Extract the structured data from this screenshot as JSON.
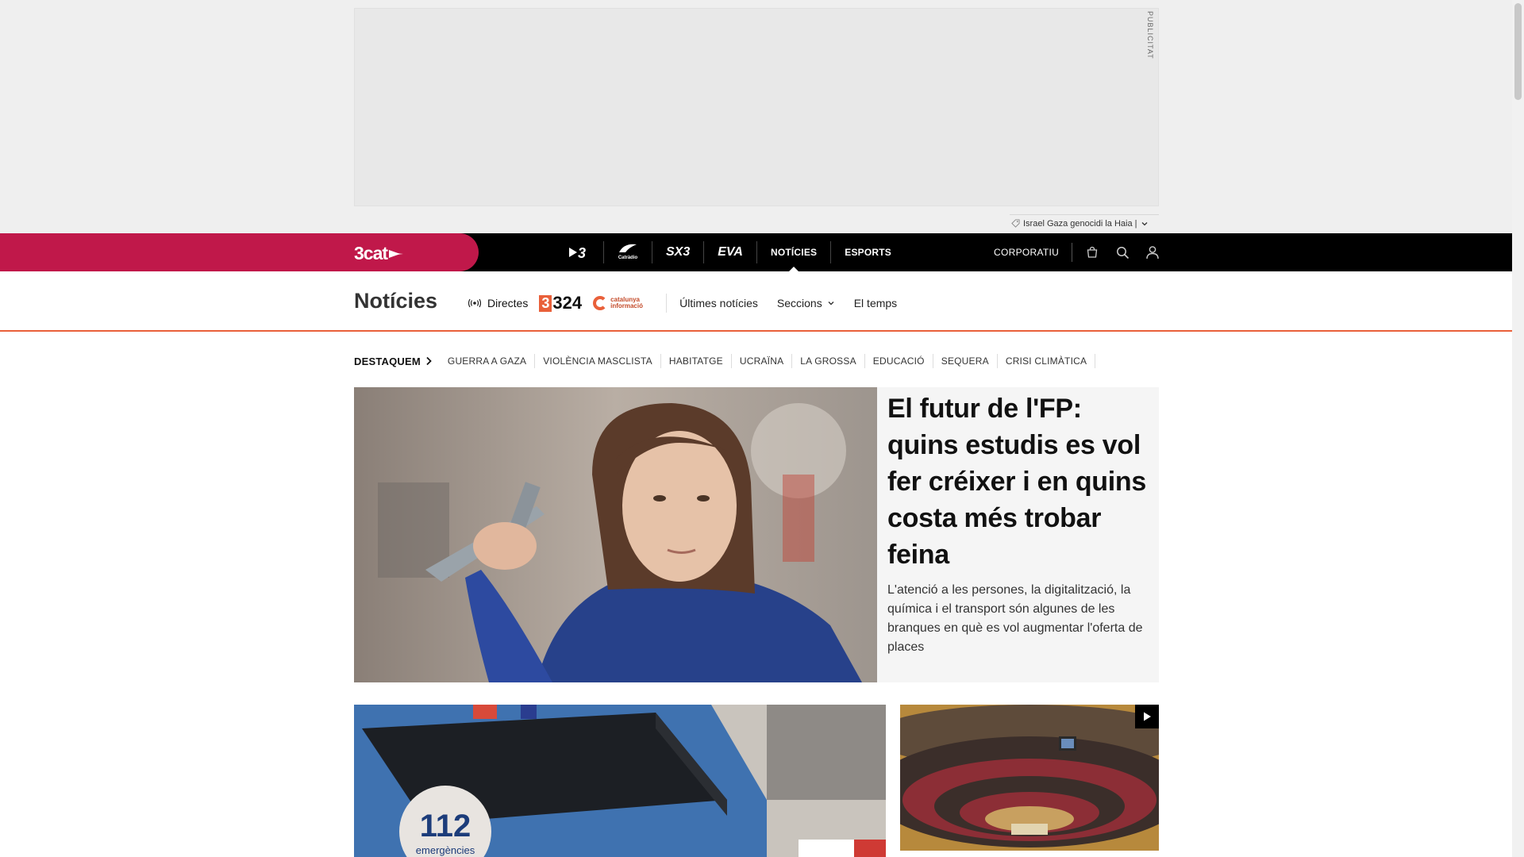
{
  "ad": {
    "label": "PUBLICITAT",
    "ticker_text": "Israel Gaza genocidi la Haia |"
  },
  "global_nav": {
    "brand": "3cat",
    "channels": [
      {
        "name": "3"
      },
      {
        "name": "Catràdio"
      },
      {
        "name": "SX3"
      },
      {
        "name": "EVA"
      }
    ],
    "links": [
      {
        "label": "NOTÍCIES",
        "active": true
      },
      {
        "label": "ESPORTS",
        "active": false
      }
    ],
    "corporate": "CORPORATIU",
    "icons": [
      "shopping-bag-icon",
      "search-icon",
      "user-icon"
    ]
  },
  "section": {
    "title": "Notícies",
    "directes": "Directes",
    "logo_324": "324",
    "logo_ci": "catalunya informació",
    "links": [
      "Últimes notícies",
      "Seccions",
      "El temps"
    ]
  },
  "highlights": {
    "title": "DESTAQUEM",
    "items": [
      "GUERRA A GAZA",
      "VIOLÈNCIA MASCLISTA",
      "HABITATGE",
      "UCRAÏNA",
      "LA GROSSA",
      "EDUCACIÓ",
      "SEQUERA",
      "CRISI CLIMÀTICA"
    ]
  },
  "lead": {
    "headline": "El futur de l'FP: quins estudis es vol fer créixer i en quins costa més trobar feina",
    "summary": "L'atenció a les persones, la digitalització, la química i el transport són algunes de les branques en què es vol augmentar l'oferta de places"
  },
  "cards": {
    "a_badge": "112",
    "a_badge_sub": "emergències"
  },
  "colors": {
    "brand": "#c0184a",
    "accent": "#e9603a",
    "nav_bg": "#000000"
  }
}
